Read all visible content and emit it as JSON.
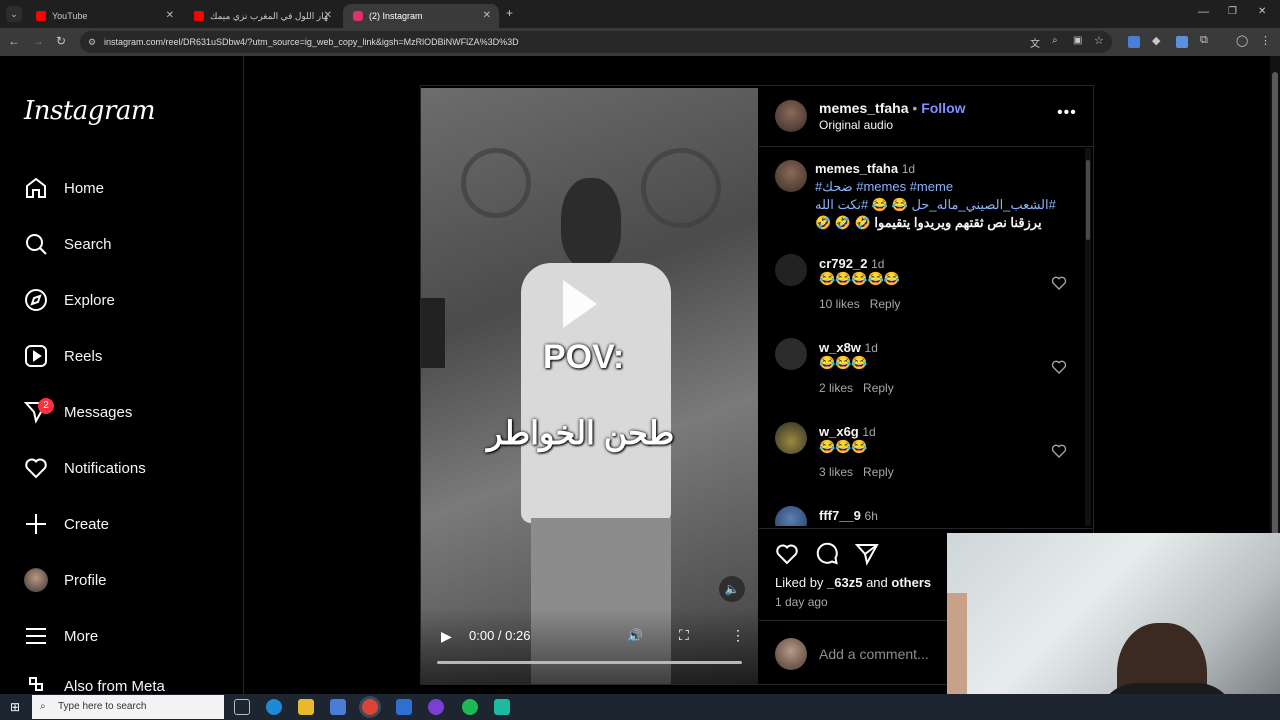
{
  "tabs": [
    {
      "title": "YouTube",
      "fav": "#ff0000"
    },
    {
      "title": "نهار اللول في المغرب نزي ميمك...",
      "fav": "#ff0000"
    },
    {
      "title": "(2) Instagram",
      "fav": "#e1306c"
    }
  ],
  "url": "instagram.com/reel/DR631uSDbw4/?utm_source=ig_web_copy_link&igsh=MzRlODBiNWFlZA%3D%3D",
  "logo": "Instagram",
  "nav": [
    {
      "label": "Home",
      "icon": "home-icon"
    },
    {
      "label": "Search",
      "icon": "search-icon"
    },
    {
      "label": "Explore",
      "icon": "compass-icon"
    },
    {
      "label": "Reels",
      "icon": "reels-icon"
    },
    {
      "label": "Messages",
      "icon": "messenger-icon",
      "badge": "2"
    },
    {
      "label": "Notifications",
      "icon": "heart-icon"
    },
    {
      "label": "Create",
      "icon": "plus-icon"
    },
    {
      "label": "Profile",
      "icon": "avatar"
    },
    {
      "label": "More",
      "icon": "hamburger-icon"
    },
    {
      "label": "Also from Meta",
      "icon": "meta-icon"
    }
  ],
  "video": {
    "overlay_top": "POV:",
    "overlay_bottom": "طحن الخواطر",
    "time": "0:00 / 0:26"
  },
  "post": {
    "username": "memes_tfaha",
    "separator": "•",
    "follow": "Follow",
    "audio": "Original audio",
    "caption_user": "memes_tfaha",
    "caption_time": "1d",
    "caption_line1": "#ضحك #memes #meme",
    "caption_line2": "#الشعب_الصيني_ماله_حل 😂 😂 #نكت الله",
    "caption_line3": "يرزقنا نص ثقتهم ويريدوا يتقيموا 🤣 🤣 🤣"
  },
  "comments": [
    {
      "user": "cr792_2",
      "time": "1d",
      "text": "😂😂😂😂😂",
      "likes": "10 likes",
      "reply": "Reply"
    },
    {
      "user": "w_x8w",
      "time": "1d",
      "text": "😂😂😂",
      "likes": "2 likes",
      "reply": "Reply"
    },
    {
      "user": "w_x6g",
      "time": "1d",
      "text": "😂😂😂",
      "likes": "3 likes",
      "reply": "Reply"
    },
    {
      "user": "fff7__9",
      "time": "6h"
    }
  ],
  "actions": {
    "liked_by_prefix": "Liked by ",
    "liked_by_user": "_63z5",
    "liked_by_and": " and ",
    "liked_by_others": "others",
    "date": "1 day ago",
    "add_comment_placeholder": "Add a comment..."
  },
  "taskbar": {
    "search_placeholder": "Type here to search"
  }
}
